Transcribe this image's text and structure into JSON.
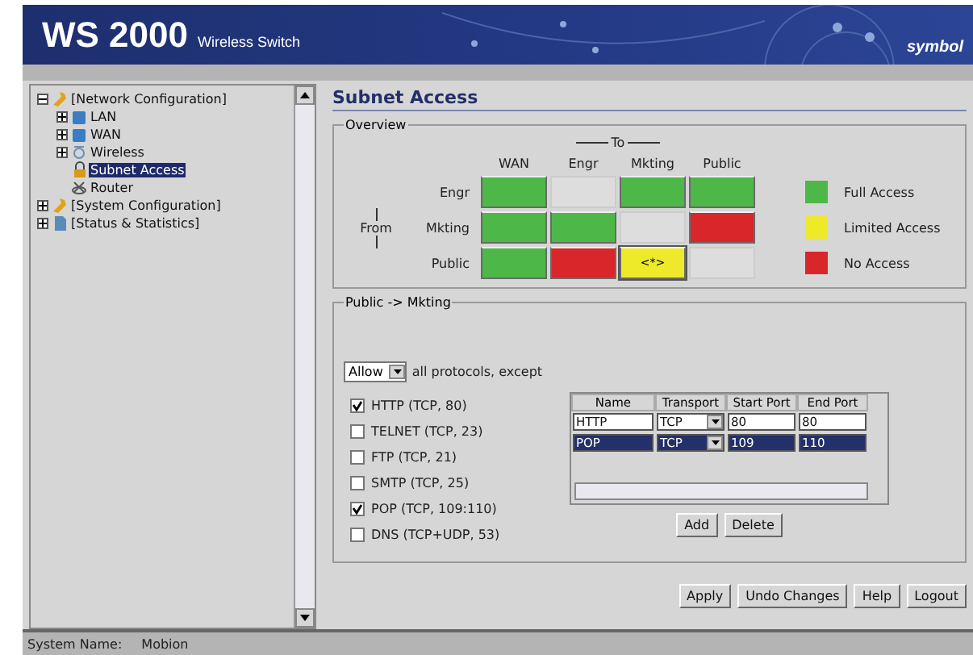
{
  "banner": {
    "title": "WS 2000",
    "subtitle": "Wireless Switch",
    "brand": "symbol"
  },
  "tree": [
    {
      "label": "[Network Configuration]",
      "expanded": true,
      "selected": false,
      "children": [
        {
          "label": "LAN",
          "expanded": false,
          "selected": false
        },
        {
          "label": "WAN",
          "expanded": false,
          "selected": false
        },
        {
          "label": "Wireless",
          "expanded": false,
          "selected": false
        },
        {
          "label": "Subnet Access",
          "selected": true
        },
        {
          "label": "Router",
          "selected": false
        }
      ]
    },
    {
      "label": "[System Configuration]",
      "expanded": false,
      "selected": false
    },
    {
      "label": "[Status & Statistics]",
      "expanded": false,
      "selected": false
    }
  ],
  "page_title": "Subnet Access",
  "overview": {
    "legend_title": "Overview",
    "to_label": "To",
    "from_label": "From",
    "columns": [
      "WAN",
      "Engr",
      "Mkting",
      "Public"
    ],
    "rows": [
      {
        "label": "Engr",
        "cells": [
          {
            "color": "#4db848"
          },
          {},
          {
            "color": "#4db848"
          },
          {
            "color": "#4db848"
          }
        ]
      },
      {
        "label": "Mkting",
        "cells": [
          {
            "color": "#4db848"
          },
          {
            "color": "#4db848"
          },
          {},
          {
            "color": "#d9262a"
          }
        ]
      },
      {
        "label": "Public",
        "cells": [
          {
            "color": "#4db848"
          },
          {
            "color": "#d9262a"
          },
          {
            "color": "#eeea2a",
            "text": "<*>",
            "selected": true
          },
          {}
        ]
      }
    ],
    "legend": [
      {
        "label": "Full Access",
        "color": "#4db848"
      },
      {
        "label": "Limited Access",
        "color": "#eeea2a"
      },
      {
        "label": "No Access",
        "color": "#d9262a"
      }
    ]
  },
  "rule": {
    "legend_title": "Public -> Mkting",
    "mode": "Allow",
    "mode_text": "all protocols, except",
    "protocols": [
      {
        "label": "HTTP (TCP, 80)",
        "checked": true
      },
      {
        "label": "TELNET (TCP, 23)",
        "checked": false
      },
      {
        "label": "FTP (TCP, 21)",
        "checked": false
      },
      {
        "label": "SMTP (TCP, 25)",
        "checked": false
      },
      {
        "label": "POP (TCP, 109:110)",
        "checked": true
      },
      {
        "label": "DNS (TCP+UDP, 53)",
        "checked": false
      }
    ],
    "table": {
      "columns": [
        "Name",
        "Transport",
        "Start Port",
        "End Port"
      ],
      "rows": [
        {
          "name": "HTTP",
          "transport": "TCP",
          "start": "80",
          "end": "80",
          "selected": false
        },
        {
          "name": "POP",
          "transport": "TCP",
          "start": "109",
          "end": "110",
          "selected": true
        }
      ]
    },
    "buttons": [
      "Add",
      "Delete"
    ]
  },
  "actions": [
    "Apply",
    "Undo Changes",
    "Help",
    "Logout"
  ],
  "status_bar": {
    "label": "System Name:",
    "value": "Mobion"
  }
}
